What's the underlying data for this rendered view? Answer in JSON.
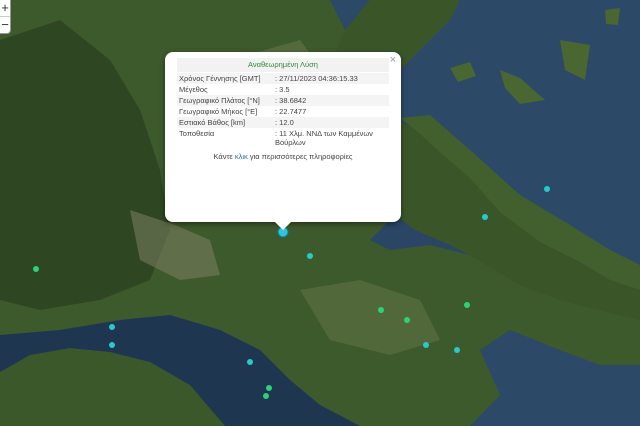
{
  "map": {
    "colors": {
      "sea_deep": "#1f3651",
      "sea": "#2c4968",
      "land": "#3d5a2c",
      "land_dark": "#2a4220",
      "land_light": "#6b7a4e",
      "mountain": "#7d7f62",
      "quake_dot": "#27c9c9",
      "quake_dot_green": "#2fd07a",
      "selected": "#31c4df"
    }
  },
  "zoom": {
    "in": "+",
    "out": "−"
  },
  "popup": {
    "title": "Αναθεωρημένη Λύση",
    "close": "×",
    "rows": [
      {
        "label": "Χρόνος Γέννησης [GMT]",
        "value": ": 27/11/2023 04:36:15.33"
      },
      {
        "label": "Μέγεθος",
        "value": ": 3.5"
      },
      {
        "label": "Γεωγραφικό Πλάτος [°N]",
        "value": ": 38.6842"
      },
      {
        "label": "Γεωγραφικό Μήκος [°E]",
        "value": ": 22.7477"
      },
      {
        "label": "Εστιακό Βάθος [km]",
        "value": ": 12.0"
      },
      {
        "label": "Τοποθεσία",
        "value": ": 11 Χλμ. ΝΝΔ των Καμμένων Βούρλων"
      }
    ],
    "footer_pre": "Κάντε ",
    "footer_link": "κλικ",
    "footer_post": " για περισσότερες πληροφορίες"
  }
}
